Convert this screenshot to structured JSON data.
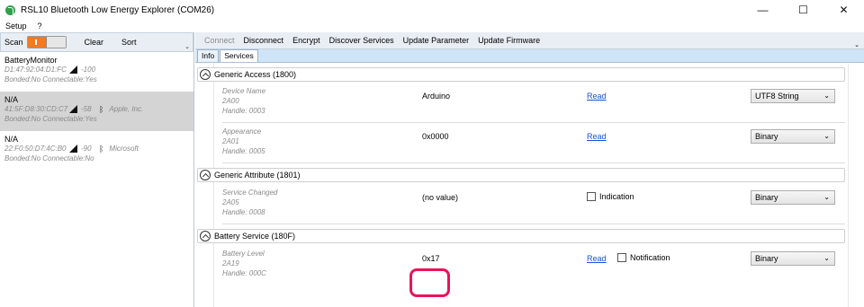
{
  "window": {
    "title": "RSL10 Bluetooth Low Energy Explorer (COM26)",
    "controls": {
      "minimize": "—",
      "maximize": "☐",
      "close": "✕"
    }
  },
  "menu": {
    "items": [
      "Setup",
      "?"
    ]
  },
  "left_toolbar": {
    "scan_label": "Scan",
    "clear_label": "Clear",
    "sort_label": "Sort",
    "overflow": "⌄"
  },
  "devices": [
    {
      "name": "BatteryMonitor",
      "address": "D1:47:92:04:D1:FC",
      "rssi": "-100",
      "vendor": "",
      "status": "Bonded:No Connectable:Yes"
    },
    {
      "name": "N/A",
      "address": "41:5F:D8:30:CD:C7",
      "rssi": "-58",
      "vendor": "Apple, Inc.",
      "status": "Bonded:No Connectable:Yes"
    },
    {
      "name": "N/A",
      "address": "22:F0:50:D7:4C:B0",
      "rssi": "-90",
      "vendor": "Microsoft",
      "status": "Bonded:No Connectable:No"
    }
  ],
  "actions": {
    "connect": "Connect",
    "disconnect": "Disconnect",
    "encrypt": "Encrypt",
    "discover": "Discover Services",
    "update_param": "Update Parameter",
    "update_fw": "Update Firmware",
    "overflow": "⌄"
  },
  "tabs": {
    "info": "Info",
    "services": "Services"
  },
  "services": [
    {
      "name": "Generic Access (1800)",
      "characteristics": [
        {
          "name": "Device Name",
          "uuid": "2A00",
          "handle": "Handle: 0003",
          "value": "Arduino",
          "read": "Read",
          "format": "UTF8 String"
        },
        {
          "name": "Appearance",
          "uuid": "2A01",
          "handle": "Handle: 0005",
          "value": "0x0000",
          "read": "Read",
          "format": "Binary"
        }
      ]
    },
    {
      "name": "Generic Attribute (1801)",
      "characteristics": [
        {
          "name": "Service Changed",
          "uuid": "2A05",
          "handle": "Handle: 0008",
          "value": "(no value)",
          "indication": "Indication",
          "format": "Binary"
        }
      ]
    },
    {
      "name": "Battery Service (180F)",
      "characteristics": [
        {
          "name": "Battery Level",
          "uuid": "2A19",
          "handle": "Handle: 000C",
          "value": "0x17",
          "read": "Read",
          "notification": "Notification",
          "format": "Binary"
        }
      ]
    }
  ],
  "icons": {
    "chevron": "⌄",
    "bluetooth": "ᛒ"
  },
  "colors": {
    "scan_toggle": "#f47a1f",
    "highlight": "#e8145a",
    "link": "#1a4fd6",
    "tab_strip": "#cfe4f6"
  }
}
